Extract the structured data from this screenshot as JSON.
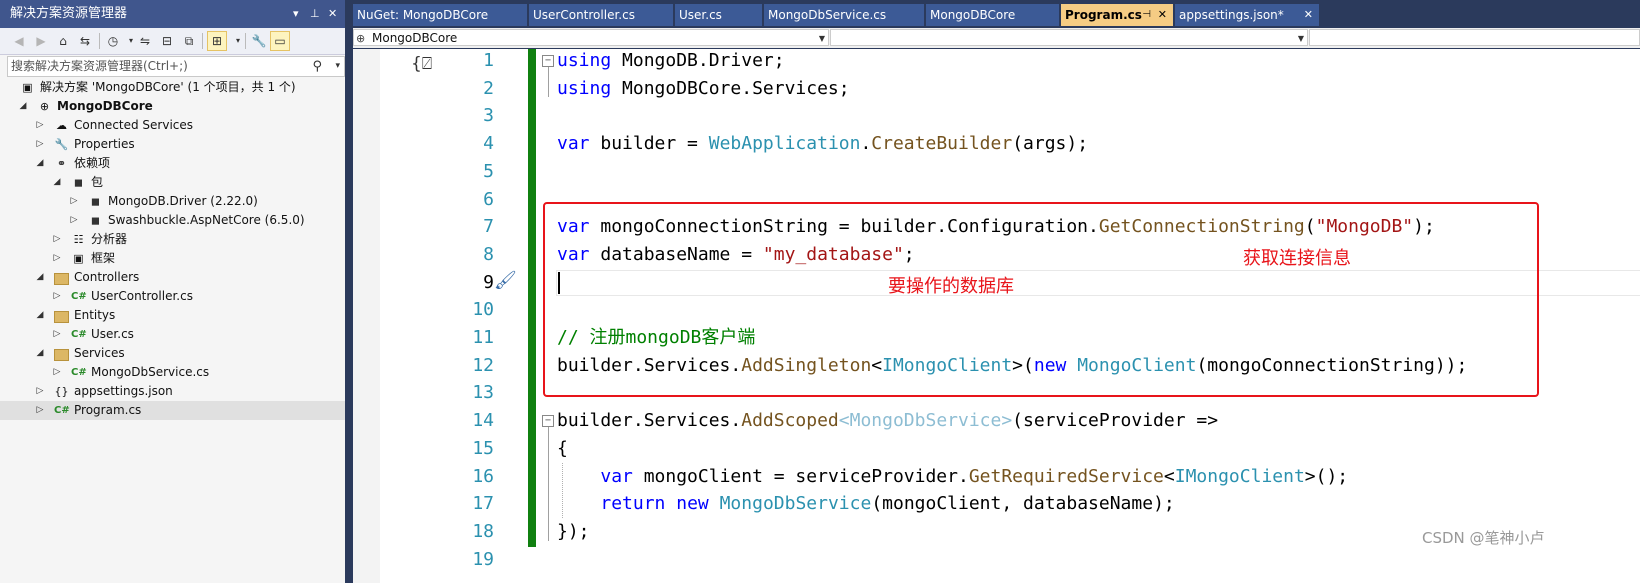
{
  "solution_explorer": {
    "title": "解决方案资源管理器",
    "title_controls": [
      "▾",
      "⊥",
      "✕"
    ],
    "search_placeholder": "搜索解决方案资源管理器(Ctrl+;)",
    "tree": [
      {
        "label": "解决方案 'MongoDBCore' (1 个项目，共 1 个)",
        "icon": "solution-icon",
        "glyph": "▣",
        "indent": 0,
        "arrow": "",
        "bold": false
      },
      {
        "label": "MongoDBCore",
        "icon": "project-icon",
        "glyph": "⊕",
        "indent": 1,
        "arrow": "◢",
        "bold": true
      },
      {
        "label": "Connected Services",
        "icon": "connected-services-icon",
        "glyph": "☁",
        "indent": 2,
        "arrow": "▷",
        "bold": false
      },
      {
        "label": "Properties",
        "icon": "properties-icon",
        "glyph": "🔧",
        "indent": 2,
        "arrow": "▷",
        "bold": false
      },
      {
        "label": "依赖项",
        "icon": "dependencies-icon",
        "glyph": "⚭",
        "indent": 2,
        "arrow": "◢",
        "bold": false
      },
      {
        "label": "包",
        "icon": "package-icon",
        "glyph": "◼",
        "indent": 3,
        "arrow": "◢",
        "bold": false
      },
      {
        "label": "MongoDB.Driver (2.22.0)",
        "icon": "nuget-package-icon",
        "glyph": "◼",
        "indent": 4,
        "arrow": "▷",
        "bold": false
      },
      {
        "label": "Swashbuckle.AspNetCore (6.5.0)",
        "icon": "nuget-package-icon",
        "glyph": "◼",
        "indent": 4,
        "arrow": "▷",
        "bold": false
      },
      {
        "label": "分析器",
        "icon": "analyzer-icon",
        "glyph": "☷",
        "indent": 3,
        "arrow": "▷",
        "bold": false
      },
      {
        "label": "框架",
        "icon": "framework-icon",
        "glyph": "▣",
        "indent": 3,
        "arrow": "▷",
        "bold": false
      },
      {
        "label": "Controllers",
        "icon": "folder-icon",
        "glyph": "",
        "indent": 2,
        "arrow": "◢",
        "bold": false
      },
      {
        "label": "UserController.cs",
        "icon": "csharp-file-icon",
        "glyph": "C#",
        "indent": 3,
        "arrow": "▷",
        "bold": false
      },
      {
        "label": "Entitys",
        "icon": "folder-icon",
        "glyph": "",
        "indent": 2,
        "arrow": "◢",
        "bold": false
      },
      {
        "label": "User.cs",
        "icon": "csharp-file-icon",
        "glyph": "C#",
        "indent": 3,
        "arrow": "▷",
        "bold": false
      },
      {
        "label": "Services",
        "icon": "folder-icon",
        "glyph": "",
        "indent": 2,
        "arrow": "◢",
        "bold": false
      },
      {
        "label": "MongoDbService.cs",
        "icon": "csharp-file-icon",
        "glyph": "C#",
        "indent": 3,
        "arrow": "▷",
        "bold": false
      },
      {
        "label": "appsettings.json",
        "icon": "json-file-icon",
        "glyph": "{}",
        "indent": 2,
        "arrow": "▷",
        "bold": false
      },
      {
        "label": "Program.cs",
        "icon": "csharp-file-icon",
        "glyph": "C#",
        "indent": 2,
        "arrow": "▷",
        "bold": false,
        "selected": true
      }
    ]
  },
  "tabs": [
    {
      "label": "NuGet: MongoDBCore",
      "active": false
    },
    {
      "label": "UserController.cs",
      "active": false
    },
    {
      "label": "User.cs",
      "active": false
    },
    {
      "label": "MongoDbService.cs",
      "active": false
    },
    {
      "label": "MongoDBCore",
      "active": false
    },
    {
      "label": "Program.cs",
      "active": true
    },
    {
      "label": "appsettings.json*",
      "active": false
    }
  ],
  "nav_bar": {
    "project_combo": "MongoDBCore",
    "type_combo": "",
    "member_combo": ""
  },
  "code_lines": [
    {
      "n": "1",
      "tokens": [
        [
          "kw",
          "using"
        ],
        [
          "pr",
          " MongoDB.Driver;"
        ]
      ]
    },
    {
      "n": "2",
      "tokens": [
        [
          "kw",
          "using"
        ],
        [
          "pr",
          " MongoDBCore.Services;"
        ]
      ]
    },
    {
      "n": "3",
      "tokens": []
    },
    {
      "n": "4",
      "tokens": [
        [
          "kw",
          "var"
        ],
        [
          "pr",
          " builder = "
        ],
        [
          "ty",
          "WebApplication"
        ],
        [
          "pr",
          "."
        ],
        [
          "mt",
          "CreateBuilder"
        ],
        [
          "pr",
          "(args);"
        ]
      ]
    },
    {
      "n": "5",
      "tokens": []
    },
    {
      "n": "6",
      "tokens": []
    },
    {
      "n": "7",
      "tokens": [
        [
          "kw",
          "var"
        ],
        [
          "pr",
          " mongoConnectionString = builder.Configuration."
        ],
        [
          "mt",
          "GetConnectionString"
        ],
        [
          "pr",
          "("
        ],
        [
          "st",
          "\"MongoDB\""
        ],
        [
          "pr",
          ");"
        ]
      ]
    },
    {
      "n": "8",
      "tokens": [
        [
          "kw",
          "var"
        ],
        [
          "pr",
          " databaseName = "
        ],
        [
          "st",
          "\"my_database\""
        ],
        [
          "pr",
          ";"
        ]
      ]
    },
    {
      "n": "9",
      "tokens": []
    },
    {
      "n": "10",
      "tokens": []
    },
    {
      "n": "11",
      "tokens": [
        [
          "cm",
          "// 注册mongoDB客户端"
        ]
      ]
    },
    {
      "n": "12",
      "tokens": [
        [
          "pr",
          "builder.Services."
        ],
        [
          "mt",
          "AddSingleton"
        ],
        [
          "pr",
          "<"
        ],
        [
          "ty",
          "IMongoClient"
        ],
        [
          "pr",
          ">("
        ],
        [
          "kw",
          "new"
        ],
        [
          "pr",
          " "
        ],
        [
          "ty",
          "MongoClient"
        ],
        [
          "pr",
          "(mongoConnectionString));"
        ]
      ]
    },
    {
      "n": "13",
      "tokens": []
    },
    {
      "n": "14",
      "tokens": [
        [
          "pr",
          "builder.Services."
        ],
        [
          "mt",
          "AddScoped"
        ],
        [
          "ty2",
          "<MongoDbService>"
        ],
        [
          "pr",
          "(serviceProvider =>"
        ]
      ]
    },
    {
      "n": "15",
      "tokens": [
        [
          "pr",
          "{"
        ]
      ]
    },
    {
      "n": "16",
      "tokens": [
        [
          "pr",
          "    "
        ],
        [
          "kw",
          "var"
        ],
        [
          "pr",
          " mongoClient = serviceProvider."
        ],
        [
          "mt",
          "GetRequiredService"
        ],
        [
          "pr",
          "<"
        ],
        [
          "ty",
          "IMongoClient"
        ],
        [
          "pr",
          ">();"
        ]
      ]
    },
    {
      "n": "17",
      "tokens": [
        [
          "pr",
          "    "
        ],
        [
          "kw",
          "return"
        ],
        [
          "pr",
          " "
        ],
        [
          "kw",
          "new"
        ],
        [
          "pr",
          " "
        ],
        [
          "ty",
          "MongoDbService"
        ],
        [
          "pr",
          "(mongoClient, databaseName);"
        ]
      ]
    },
    {
      "n": "18",
      "tokens": [
        [
          "pr",
          "});"
        ]
      ]
    },
    {
      "n": "19",
      "tokens": []
    }
  ],
  "annotations": {
    "get_connection_info": "获取连接信息",
    "database_to_operate": "要操作的数据库"
  },
  "watermark": "CSDN @笔神小卢",
  "colors": {
    "title_bar": "#40568d",
    "active_tab": "#f5cc84",
    "change_bar": "#108010",
    "annotation_red": "#e8141a"
  }
}
